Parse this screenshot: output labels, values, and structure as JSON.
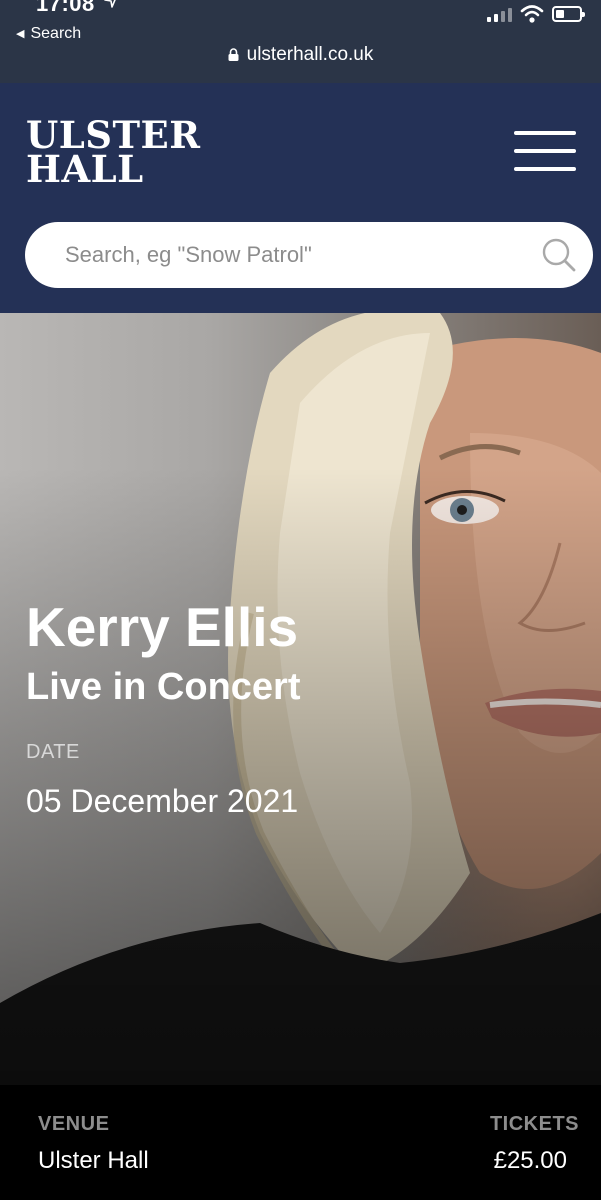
{
  "status_bar": {
    "time": "17:08",
    "back_label": "Search",
    "url": "ulsterhall.co.uk",
    "battery_level": 0.35
  },
  "header": {
    "logo_line1": "ULSTER",
    "logo_line2": "HALL",
    "background_color": "#243156"
  },
  "search": {
    "placeholder": "Search, eg \"Snow Patrol\""
  },
  "event": {
    "title": "Kerry Ellis",
    "subtitle": "Live in Concert",
    "date_label": "DATE",
    "date_value": "05 December 2021"
  },
  "info_bar": {
    "venue_label": "VENUE",
    "venue_value": "Ulster Hall",
    "tickets_label": "TICKETS",
    "tickets_value": "£25.00"
  }
}
